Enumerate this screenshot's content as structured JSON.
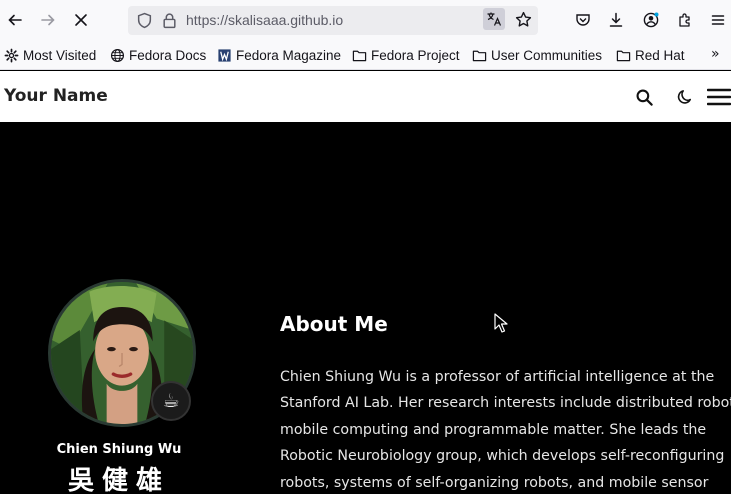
{
  "browser": {
    "url": "https://skalisaaa.github.io",
    "bookmarks": [
      {
        "label": "Most Visited",
        "icon": "gear-icon"
      },
      {
        "label": "Fedora Docs",
        "icon": "globe-icon"
      },
      {
        "label": "Fedora Magazine",
        "icon": "fedora-magazine-icon"
      },
      {
        "label": "Fedora Project",
        "icon": "folder-icon"
      },
      {
        "label": "User Communities",
        "icon": "folder-icon"
      },
      {
        "label": "Red Hat",
        "icon": "folder-icon"
      }
    ],
    "overflow": "»"
  },
  "site": {
    "title": "Your Name"
  },
  "profile": {
    "name": "Chien Shiung Wu",
    "name_cjk": "吳健雄",
    "badge": "☕"
  },
  "about": {
    "title": "About Me",
    "lines": [
      "Chien Shiung Wu is a professor of artificial intelligence at the",
      "Stanford AI Lab. Her research interests include distributed robotics,",
      "mobile computing and programmable matter. She leads the",
      "Robotic Neurobiology group, which develops self-reconfiguring",
      "robots, systems of self-organizing robots, and mobile sensor"
    ]
  },
  "colors": {
    "page_bg": "#000000",
    "header_bg": "#ffffff",
    "browser_chrome": "#f9f9fb"
  }
}
